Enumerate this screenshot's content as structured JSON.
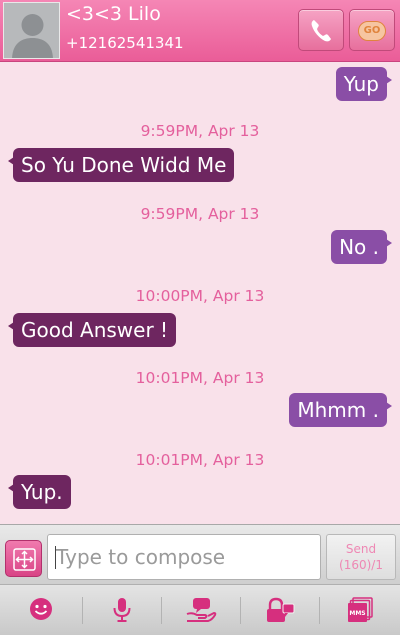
{
  "header": {
    "contact_name": "<3<3 Lilo",
    "contact_number": "+12162541341",
    "call_icon": "phone-icon",
    "go_icon": "go-icon",
    "go_label": "GO"
  },
  "messages": [
    {
      "direction": "out",
      "text": "Yup"
    },
    {
      "timestamp": "9:59PM, Apr 13",
      "direction": "in",
      "text": "So Yu Done Widd Me"
    },
    {
      "timestamp": "9:59PM, Apr 13",
      "direction": "out",
      "text": "No ."
    },
    {
      "timestamp": "10:00PM, Apr 13",
      "direction": "in",
      "text": "Good Answer !"
    },
    {
      "timestamp": "10:01PM, Apr 13",
      "direction": "out",
      "text": "Mhmm ."
    },
    {
      "timestamp": "10:01PM, Apr 13",
      "direction": "in",
      "text": "Yup."
    }
  ],
  "compose": {
    "placeholder": "Type to compose",
    "send_label": "Send",
    "counter": "(160)/1",
    "attach_icon": "attachment-icon"
  },
  "toolbar": {
    "icons": [
      "smiley-icon",
      "microphone-icon",
      "quick-text-icon",
      "privacy-lock-icon",
      "mms-icon"
    ],
    "mms_label": "MMS"
  },
  "colors": {
    "header_pink": "#ea5d98",
    "background": "#f9e1ea",
    "incoming_bubble": "#6e2660",
    "outgoing_bubble": "#8a4ea6",
    "timestamp": "#e4609d"
  }
}
